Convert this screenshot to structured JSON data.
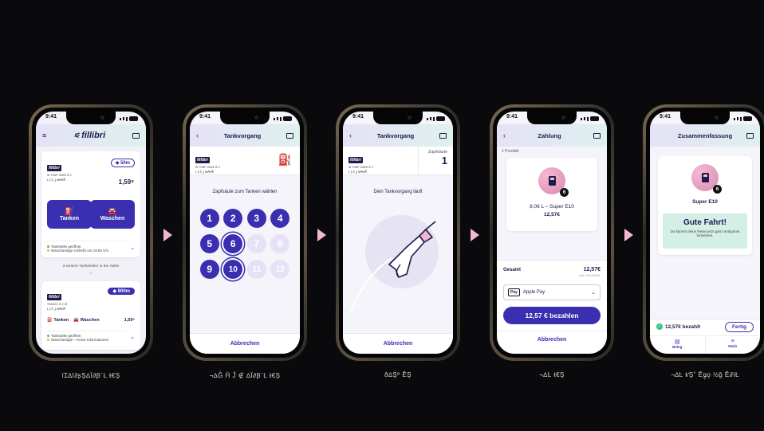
{
  "status_time": "9:41",
  "captions": [
    "ïꞮ∆î∂ʂŞ∆Ï∂Ꞵ᾽Ŀ ᵵ€Ş",
    "¬∆Ĝ Ĥ Ĵ ∉ ∆Ï∂Ꞵ᾽Ŀ ᵵ€Ş",
    "ð∆Şº ÊŞ",
    "¬∆Ŀ ᵵ€Ş",
    "¬∆Ŀ ᵵ∕Ş˚ Êǥ᷊ǫ ½ǧ Ê∂ïŁ"
  ],
  "screen1": {
    "logo": "fillibri",
    "station1": {
      "brand": "fillibri",
      "addr1": "ᴡ ᴛʜᴀᴘ ᴢᴀᴋᴋ Ɛ ɪ",
      "addr2": "ɪ ∫ ⁄ɪ ʝ ᴍ₳ᴋ₴",
      "distance": "50m",
      "price": "1,59⁹"
    },
    "btn_tanken": "Tanken",
    "btn_waschen": "Waschen",
    "open1": "Tankstelle geöffnet",
    "open2": "Waschanlage schließt um 19:00 Uhr",
    "more": "3 weitere Tankstellen in der Nähe",
    "station2": {
      "brand": "fillibri",
      "addr1": "ᴛʜᴀᴋɢᴢ Ɛ ɪ ɪɪ",
      "addr2": "ɪ ∫ ⁄ɪ ʝ ᴍ₳ᴋ₴",
      "distance": "900m",
      "tanken": "Tanken",
      "waschen": "Waschen",
      "price": "1,59⁹"
    },
    "s2_open": "Tankstelle geöffnet",
    "s2_info": "Waschanlage – Keine Informationen"
  },
  "screen2": {
    "title": "Tankvorgang",
    "brand": "fillibri",
    "addr1": "ᴡ ᴛʜᴀᴘ ᴢᴀᴋᴋ Ɛ ɪ",
    "addr2": "ɪ ∫ ⁄ɪ ʝ ᴍ₳ᴋ₴",
    "prompt": "Zapfsäule zum Tanken wählen",
    "numbers": [
      "1",
      "2",
      "3",
      "4",
      "5",
      "6",
      "7",
      "8",
      "9",
      "10",
      "11",
      "12"
    ],
    "cancel": "Abbrechen"
  },
  "screen3": {
    "title": "Tankvorgang",
    "brand": "fillibri",
    "addr1": "ᴡ ᴛʜᴀᴘ ᴢᴀᴋᴋ Ɛ ɪ",
    "addr2": "ɪ ∫ ⁄ɪ ʝ ᴍ₳ᴋ₴",
    "pump_label": "Zapfsäule",
    "pump_no": "1",
    "status": "Dein Tankvorgang läuft",
    "cancel": "Abbrechen"
  },
  "screen4": {
    "title": "Zahlung",
    "count": "1 Produkt",
    "badge": "6",
    "product": "8,06 L – Super E10",
    "product_price": "12,57€",
    "total_label": "Gesamt",
    "total": "12,57€",
    "vat": "inkl. 19% MwSt.",
    "pay_logo": "Pay",
    "pay_method": "Apple Pay",
    "pay_btn": "12,57 € bezahlen",
    "cancel": "Abbrechen"
  },
  "screen5": {
    "title": "Zusammenfassung",
    "badge": "6",
    "product": "Super E10",
    "greeting": "Gute Fahrt!",
    "msg": "Du kannst deine Reise jetzt ganz entspannt fortsetzen.",
    "paid": "12,57€ bezahlt",
    "done": "Fertig",
    "tab_beleg": "Beleg",
    "tab_notiz": "Notiz"
  }
}
